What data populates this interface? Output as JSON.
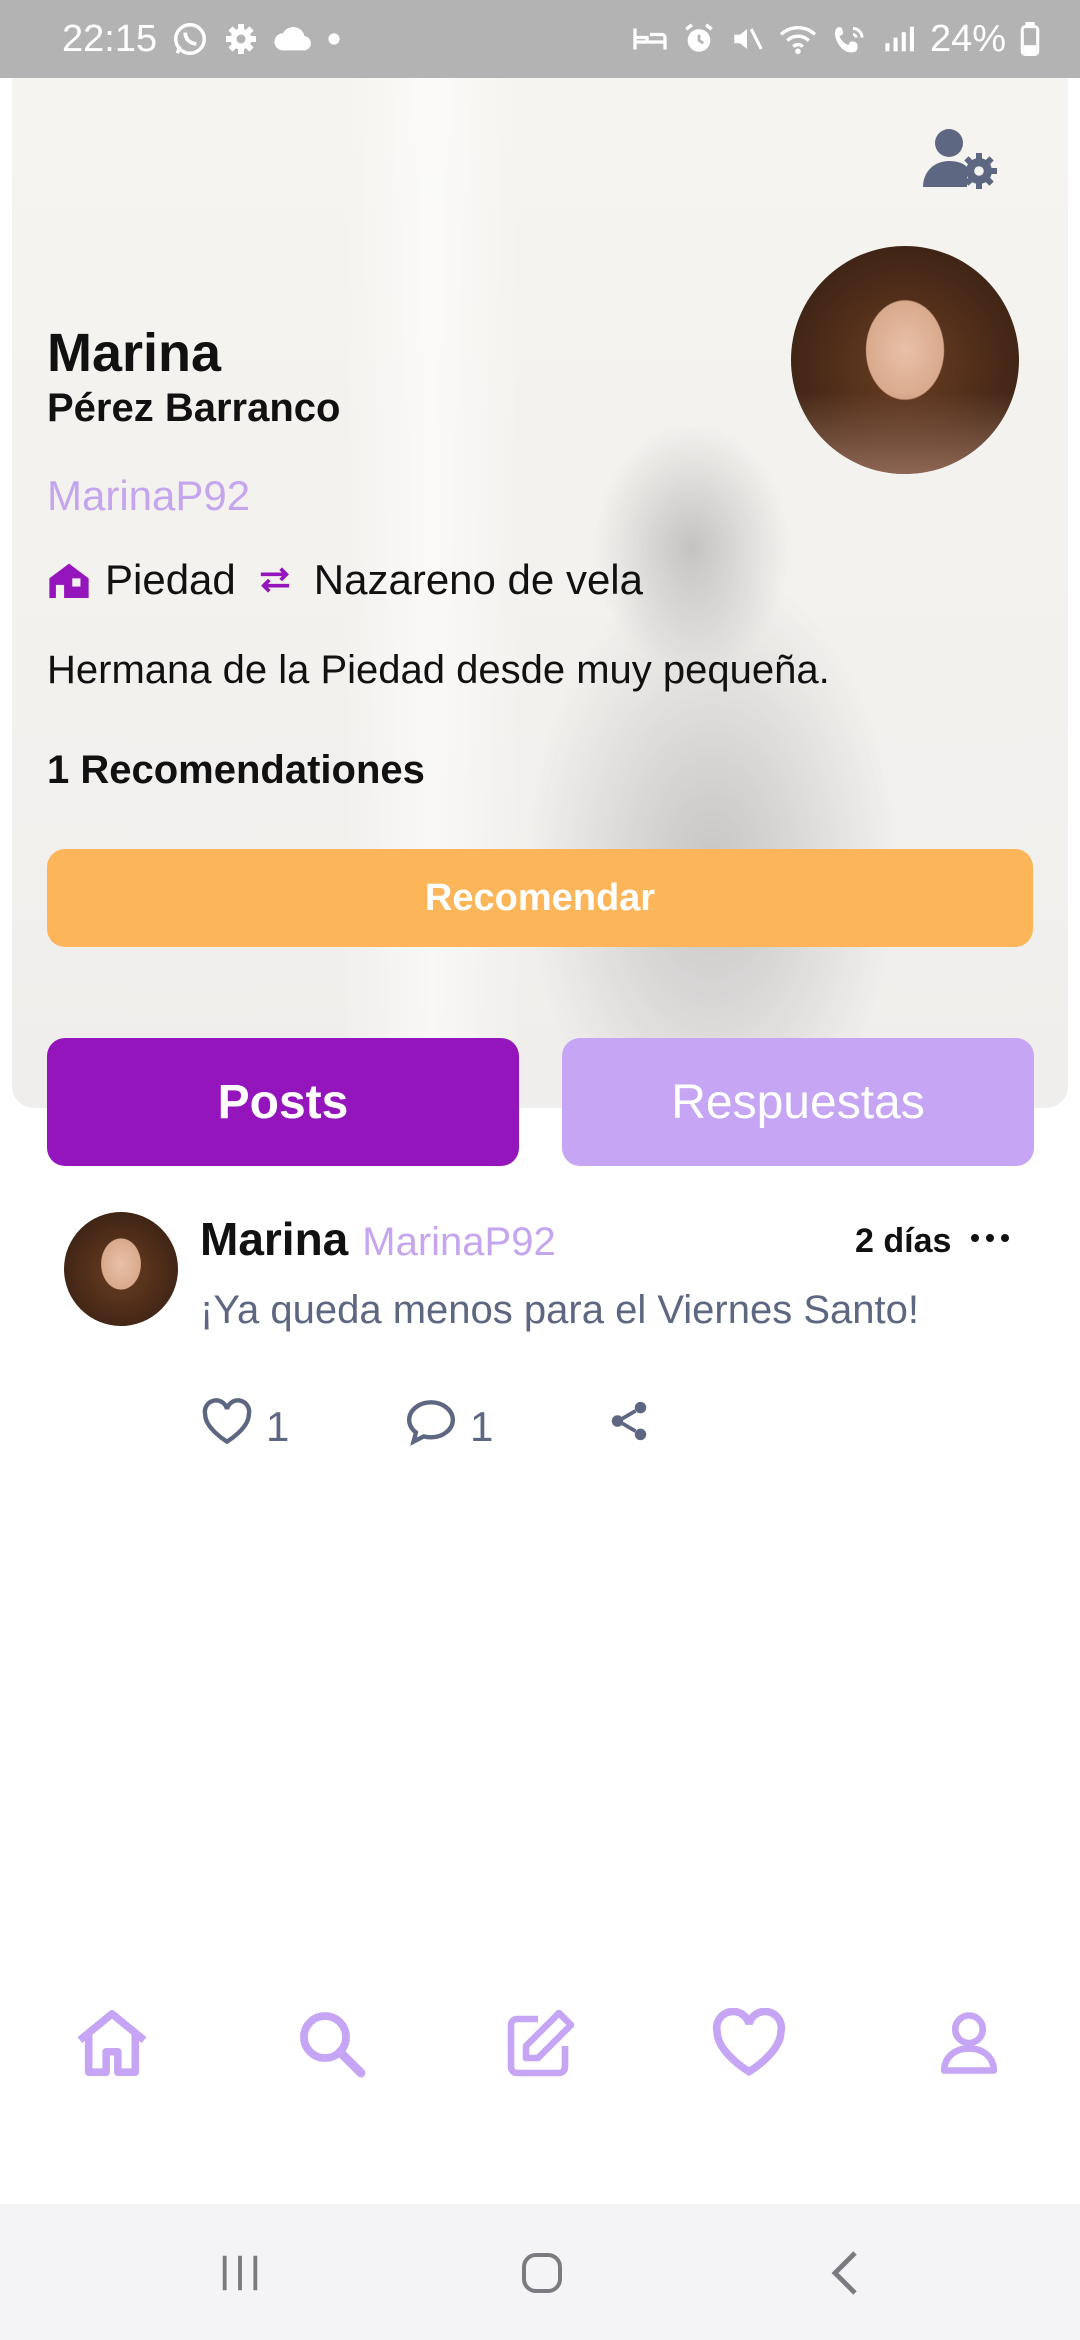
{
  "status": {
    "time": "22:15",
    "battery": "24%"
  },
  "profile": {
    "first_name": "Marina",
    "last_name": "Pérez Barranco",
    "username": "MarinaP92",
    "brotherhood": "Piedad",
    "role": "Nazareno de vela",
    "bio": "Hermana de la Piedad desde muy pequeña.",
    "recommendations": "1 Recomendationes",
    "recommend_button": "Recomendar"
  },
  "tabs": {
    "posts": "Posts",
    "replies": "Respuestas"
  },
  "post": {
    "name": "Marina",
    "username": "MarinaP92",
    "time": "2 días",
    "text": "¡Ya queda menos para el Viernes Santo!",
    "likes": "1",
    "comments": "1"
  },
  "colors": {
    "accent": "#9515bc",
    "accent_light": "#c6a6f4",
    "orange": "#fdb55a",
    "username": "#c5a6ee",
    "icon_gray": "#5e6782"
  },
  "icons": {
    "settings": "user-gear-icon",
    "brotherhood": "house-icon",
    "role": "swap-arrows-icon",
    "like": "heart-icon",
    "comment": "comment-icon",
    "share": "share-icon",
    "nav": [
      "home-icon",
      "search-icon",
      "edit-icon",
      "heart-icon",
      "user-icon"
    ]
  }
}
